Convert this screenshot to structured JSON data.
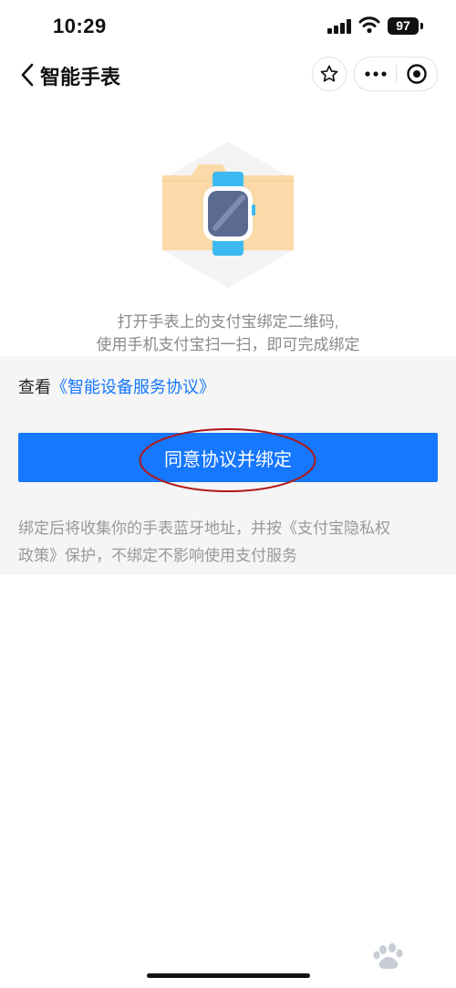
{
  "status_bar": {
    "time": "10:29",
    "battery": "97",
    "icons": [
      "signal-icon",
      "wifi-icon",
      "battery-icon"
    ]
  },
  "nav": {
    "title": "智能手表",
    "icons": [
      "back-icon",
      "star-icon",
      "more-icon",
      "close-target-icon"
    ]
  },
  "illustration": {
    "icon": "smartwatch-folder-icon",
    "colors": {
      "hexagon": "#f3f3f3",
      "folder": "#fcd9a8",
      "strap": "#3cb9f0",
      "face": "#5b6a91"
    }
  },
  "instruction": {
    "line1": "打开手表上的支付宝绑定二维码,",
    "line2": "使用手机支付宝扫一扫，即可完成绑定"
  },
  "agreement": {
    "prefix": "查看",
    "link": "《智能设备服务协议》"
  },
  "agree_button": {
    "label": "同意协议并绑定"
  },
  "notice": {
    "line1": "绑定后将收集你的手表蓝牙地址，并按《支付宝隐私权",
    "line2": "政策》保护，不绑定不影响使用支付服务"
  },
  "colors": {
    "accent": "#1677ff",
    "section_bg": "#f5f5f5",
    "annotation": "#b01818"
  }
}
